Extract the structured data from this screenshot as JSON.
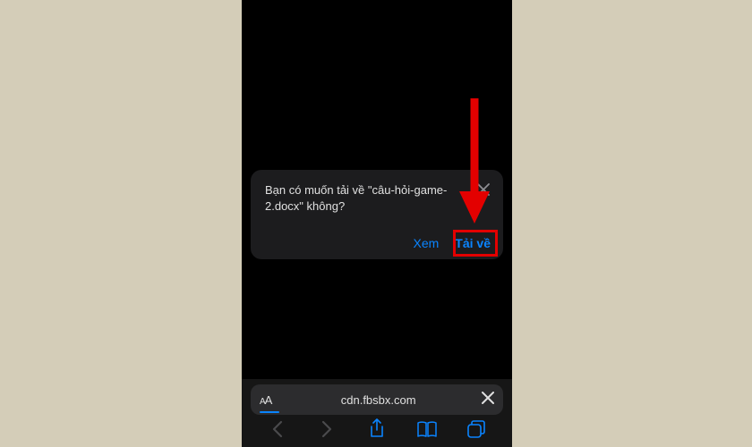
{
  "dialog": {
    "message": "Bạn có muốn tải về \"câu-hỏi-game-2.docx\" không?",
    "view_label": "Xem",
    "download_label": "Tải về"
  },
  "url_bar": {
    "domain": "cdn.fbsbx.com",
    "aa_label": "AA"
  },
  "annotation": {
    "highlight_target": "download-button"
  }
}
